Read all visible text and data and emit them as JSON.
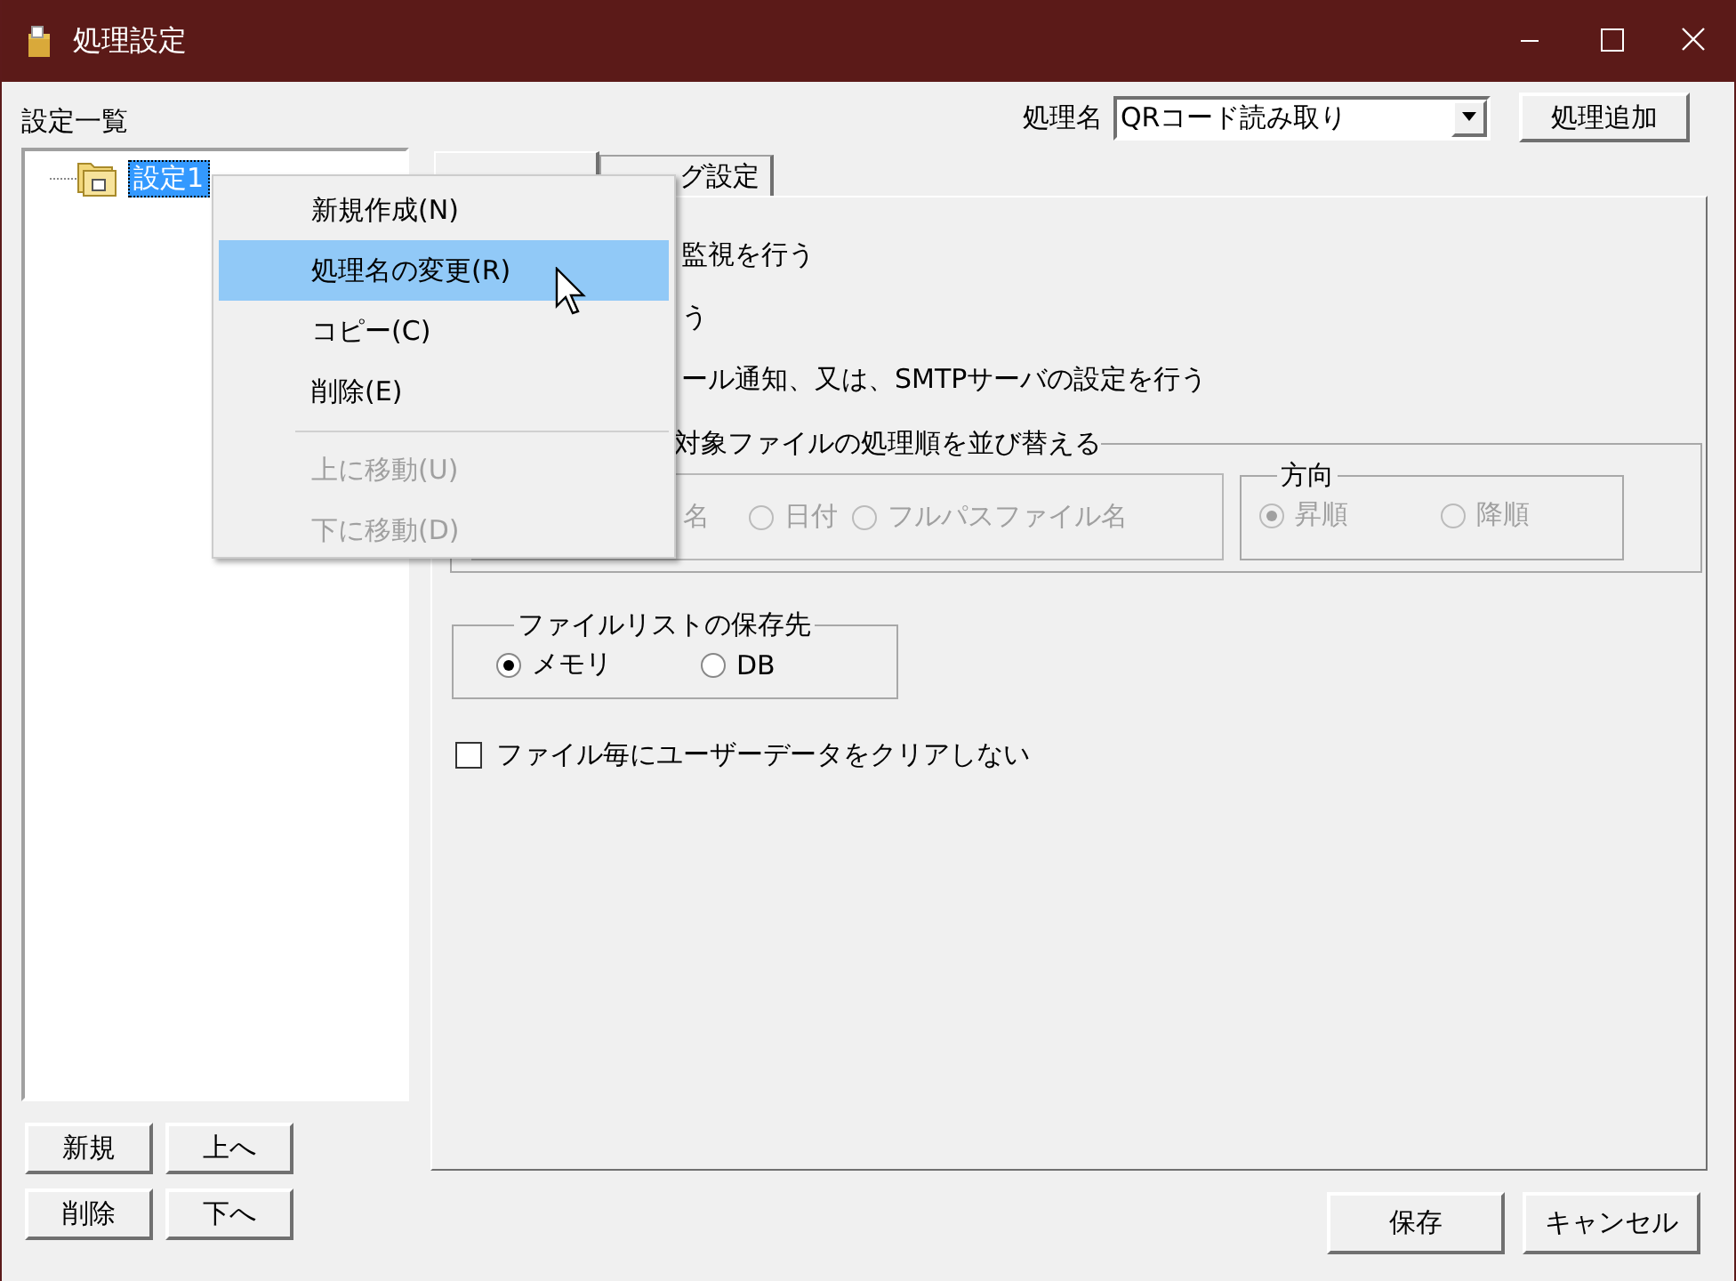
{
  "window": {
    "title": "処理設定"
  },
  "settings_list": {
    "label": "設定一覧",
    "tree": [
      {
        "label": "設定1",
        "selected": true
      }
    ]
  },
  "left_buttons": [
    "新規",
    "上へ",
    "削除",
    "下へ"
  ],
  "process_name": {
    "label": "処理名",
    "value": "QRコード読み取り"
  },
  "add_button": "処理追加",
  "tabs": [
    {
      "selected": true
    },
    {
      "label": "グ設定",
      "selected": false
    }
  ],
  "options": [
    {
      "text": "監視を行う"
    },
    {
      "text": "う"
    },
    {
      "text": "ール通知、又は、SMTPサーバの設定を行う"
    }
  ],
  "sort_group": {
    "title": "対象ファイルの処理順を並び替える",
    "disabled": true,
    "key_options": [
      {
        "kind": "text",
        "label": "名"
      },
      {
        "kind": "radio",
        "label": "日付",
        "selected": false
      },
      {
        "kind": "radio",
        "label": "フルパスファイル名",
        "selected": false
      }
    ],
    "direction": {
      "title": "方向",
      "options": [
        {
          "label": "昇順",
          "selected": true
        },
        {
          "label": "降順",
          "selected": false
        }
      ]
    }
  },
  "storage": {
    "title": "ファイルリストの保存先",
    "options": [
      {
        "label": "メモリ",
        "selected": true
      },
      {
        "label": "DB",
        "selected": false
      }
    ]
  },
  "clear_checkbox": {
    "label": "ファイル毎にユーザーデータをクリアしない",
    "checked": false
  },
  "context_menu": [
    {
      "kind": "item",
      "label": "新規作成(N)",
      "selected": false,
      "disabled": false
    },
    {
      "kind": "item",
      "label": "処理名の変更(R)",
      "selected": true,
      "disabled": false
    },
    {
      "kind": "item",
      "label": "コピー(C)",
      "selected": false,
      "disabled": false
    },
    {
      "kind": "item",
      "label": "削除(E)",
      "selected": false,
      "disabled": false
    },
    {
      "kind": "separator"
    },
    {
      "kind": "item",
      "label": "上に移動(U)",
      "selected": false,
      "disabled": true
    },
    {
      "kind": "item",
      "label": "下に移動(D)",
      "selected": false,
      "disabled": true
    }
  ],
  "footer_buttons": [
    "保存",
    "キャンセル"
  ]
}
